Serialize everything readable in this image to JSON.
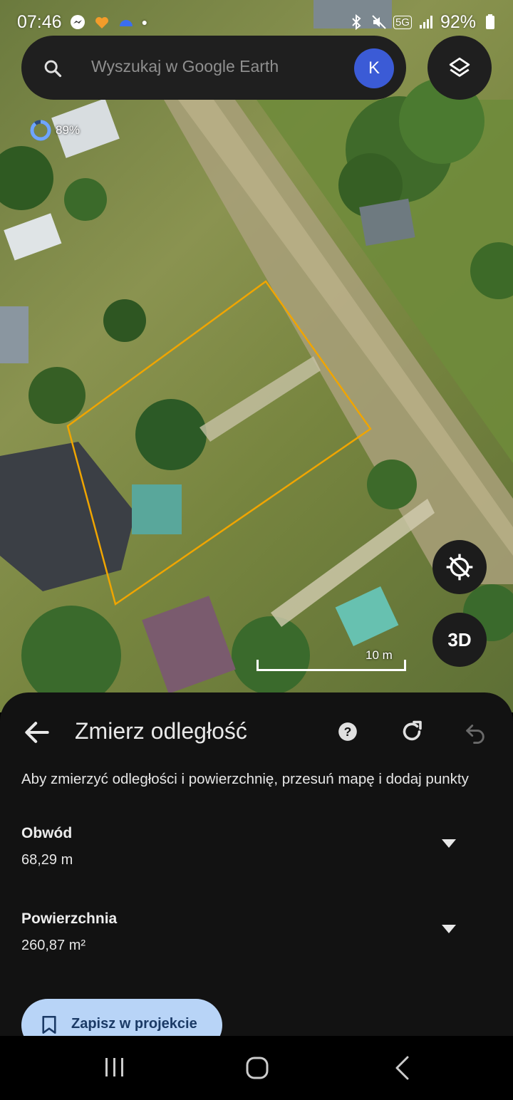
{
  "status_bar": {
    "time": "07:46",
    "battery": "92%",
    "network": "5G"
  },
  "search": {
    "placeholder": "Wyszukaj w Google Earth",
    "avatar_letter": "K"
  },
  "map": {
    "loading_percent": "89%",
    "scale_label": "10 m",
    "three_d_label": "3D",
    "polygon_color": "#f0a500"
  },
  "sheet": {
    "title": "Zmierz odległość",
    "instructions": "Aby zmierzyć odległości i powierzchnię, przesuń mapę i dodaj punkty",
    "perimeter": {
      "label": "Obwód",
      "value": "68,29 m"
    },
    "area": {
      "label": "Powierzchnia",
      "value": "260,87 m²"
    },
    "save_label": "Zapisz w projekcie"
  },
  "colors": {
    "accent_blue": "#3b5bd6",
    "save_button_bg": "#b8d4f7",
    "sheet_bg": "#121212"
  },
  "icons": [
    "messenger-icon",
    "heart-icon",
    "weather-icon",
    "bluetooth-icon",
    "mute-icon",
    "signal-icon",
    "battery-icon",
    "search-icon",
    "layers-icon",
    "gps-off-icon",
    "back-arrow-icon",
    "help-icon",
    "refresh-icon",
    "undo-icon",
    "bookmark-icon",
    "chevron-down-icon"
  ]
}
